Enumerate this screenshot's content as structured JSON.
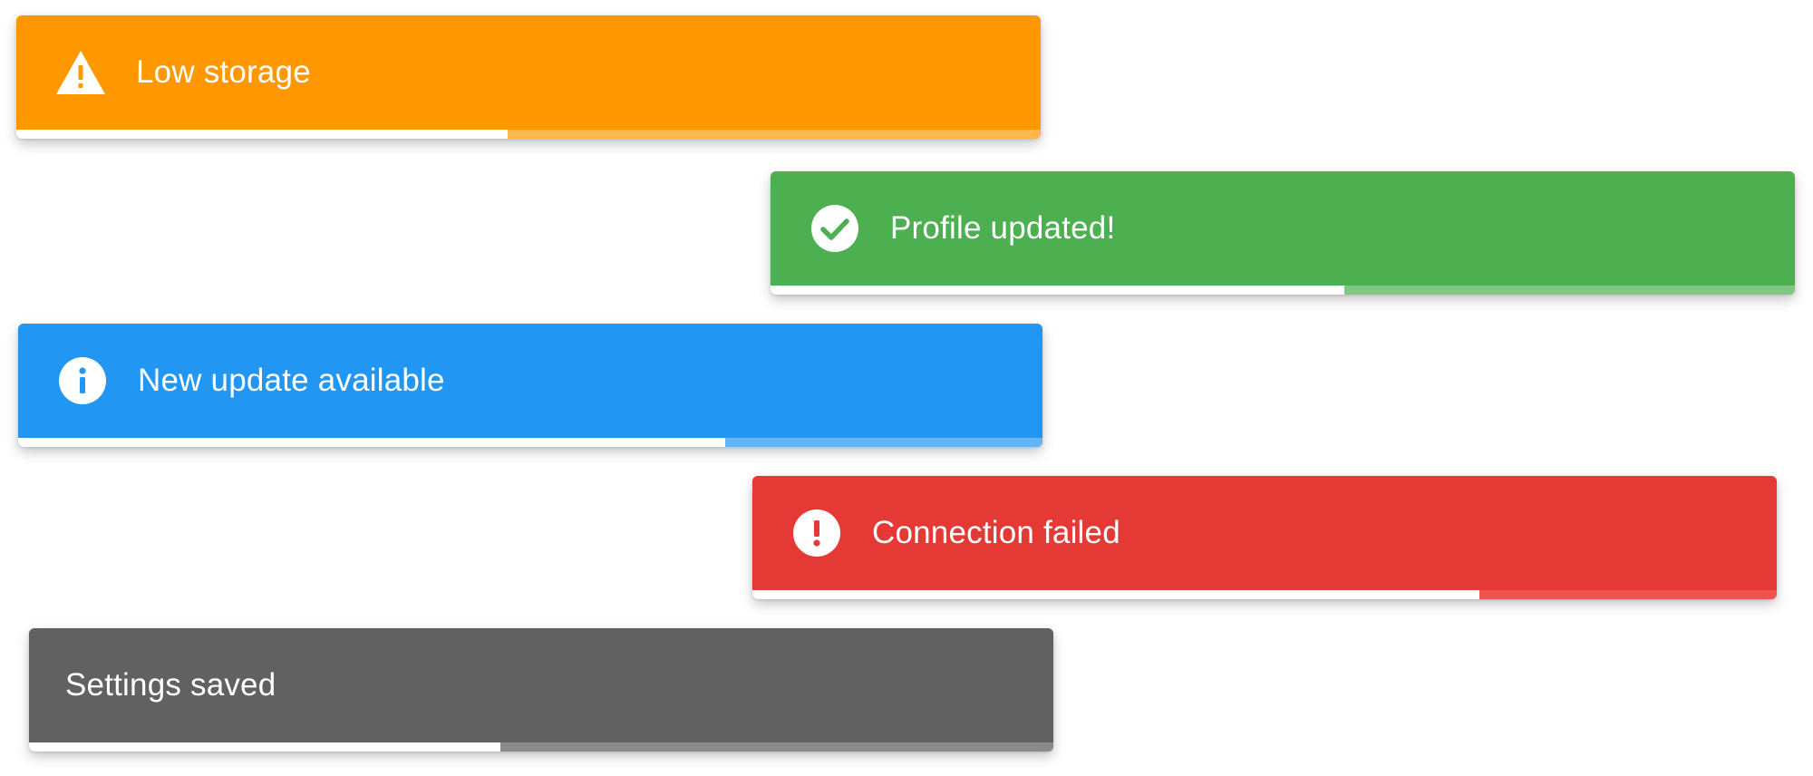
{
  "toasts": [
    {
      "id": "warning",
      "message": "Low storage",
      "icon": "warning-icon",
      "bg_color": "#FF9800",
      "track_color": "#FFB74D",
      "progress": 0.48
    },
    {
      "id": "success",
      "message": "Profile updated!",
      "icon": "check-circle-icon",
      "bg_color": "#4CAF50",
      "track_color": "#81C784",
      "progress": 0.56
    },
    {
      "id": "info",
      "message": "New update available",
      "icon": "info-icon",
      "bg_color": "#2196F3",
      "track_color": "#64B5F6",
      "progress": 0.69
    },
    {
      "id": "error",
      "message": "Connection failed",
      "icon": "error-icon",
      "bg_color": "#E53935",
      "track_color": "#EF5350",
      "progress": 0.71
    },
    {
      "id": "neutral",
      "message": "Settings saved",
      "icon": "",
      "bg_color": "#616161",
      "track_color": "#8A8A8A",
      "progress": 0.46
    }
  ]
}
